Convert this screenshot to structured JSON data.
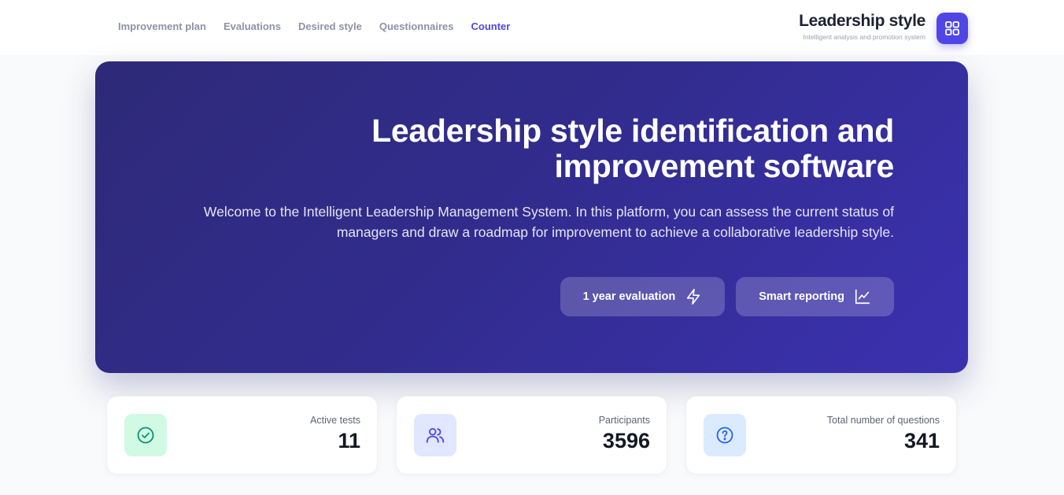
{
  "nav": {
    "items": [
      {
        "label": "Improvement plan"
      },
      {
        "label": "Evaluations"
      },
      {
        "label": "Desired style"
      },
      {
        "label": "Questionnaires"
      },
      {
        "label": "Counter"
      }
    ],
    "active": "Counter"
  },
  "brand": {
    "title": "Leadership style",
    "subtitle": "Intelligent analysis and promotion system",
    "logo_icon": "grid-icon"
  },
  "hero": {
    "title": "Leadership style identification and improvement software",
    "description": "Welcome to the Intelligent Leadership Management System. In this platform, you can assess the current status of managers and draw a roadmap for improvement to achieve a collaborative leadership style.",
    "buttons": [
      {
        "label": "1 year evaluation",
        "icon": "lightning-icon"
      },
      {
        "label": "Smart reporting",
        "icon": "chart-icon"
      }
    ]
  },
  "stats": [
    {
      "label": "Active tests",
      "value": "11",
      "icon": "check-circle-icon",
      "color": "#16a34a",
      "bg": "#d1fae5"
    },
    {
      "label": "Participants",
      "value": "3596",
      "icon": "users-icon",
      "color": "#4f46e5",
      "bg": "#e0e7ff"
    },
    {
      "label": "Total number of questions",
      "value": "341",
      "icon": "question-circle-icon",
      "color": "#2563eb",
      "bg": "#dbeafe"
    }
  ],
  "colors": {
    "accent": "#4f46e5",
    "hero_start": "#2e2a78",
    "hero_end": "#3b31b0"
  }
}
